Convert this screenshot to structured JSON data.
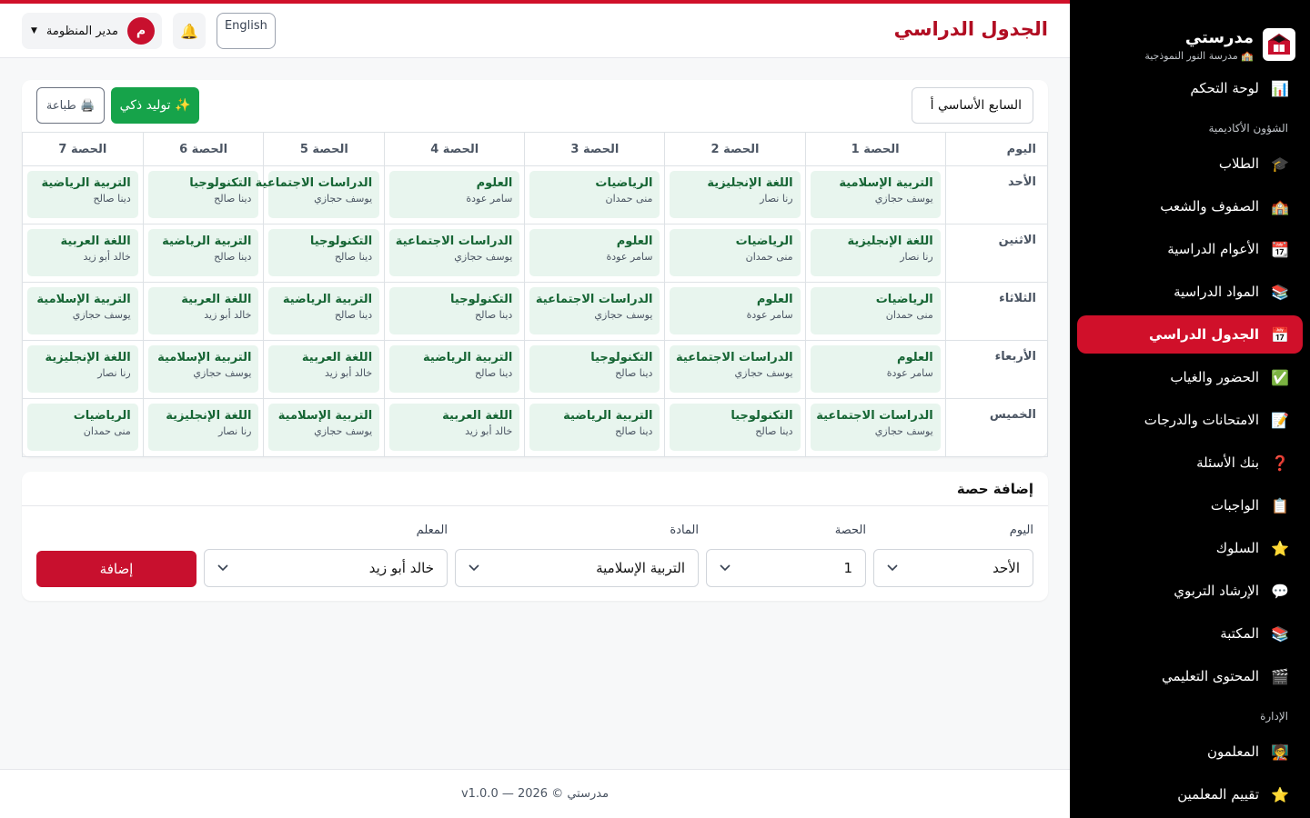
{
  "colors": {
    "accent": "#d0102a",
    "sidebar_bg": "#000000",
    "success": "#16a34a",
    "lesson_bg": "#e8f5ee",
    "lesson_text": "#166534"
  },
  "brand": {
    "name": "مدرستي",
    "school": "🏫 مدرسة النور النموذجية",
    "logo_icon": "school-logo-icon"
  },
  "sidebar": {
    "top": [
      {
        "label": "لوحة التحكم",
        "icon": "📊",
        "icon_name": "dashboard-icon"
      }
    ],
    "sections": [
      {
        "title": "الشؤون الأكاديمية",
        "items": [
          {
            "label": "الطلاب",
            "icon": "🎓",
            "icon_name": "graduation-cap-icon"
          },
          {
            "label": "الصفوف والشعب",
            "icon": "🏫",
            "icon_name": "school-icon"
          },
          {
            "label": "الأعوام الدراسية",
            "icon": "📆",
            "icon_name": "calendar-icon"
          },
          {
            "label": "المواد الدراسية",
            "icon": "📚",
            "icon_name": "books-icon"
          },
          {
            "label": "الجدول الدراسي",
            "icon": "📅",
            "icon_name": "timetable-icon",
            "active": true
          },
          {
            "label": "الحضور والغياب",
            "icon": "✅",
            "icon_name": "check-icon"
          },
          {
            "label": "الامتحانات والدرجات",
            "icon": "📝",
            "icon_name": "memo-icon"
          },
          {
            "label": "بنك الأسئلة",
            "icon": "❓",
            "icon_name": "question-icon"
          },
          {
            "label": "الواجبات",
            "icon": "📋",
            "icon_name": "clipboard-icon"
          },
          {
            "label": "السلوك",
            "icon": "⭐",
            "icon_name": "star-icon"
          },
          {
            "label": "الإرشاد التربوي",
            "icon": "💬",
            "icon_name": "speech-bubble-icon"
          },
          {
            "label": "المكتبة",
            "icon": "📚",
            "icon_name": "library-icon"
          },
          {
            "label": "المحتوى التعليمي",
            "icon": "🎬",
            "icon_name": "clapperboard-icon"
          }
        ]
      },
      {
        "title": "الإدارة",
        "items": [
          {
            "label": "المعلمون",
            "icon": "🧑‍🏫",
            "icon_name": "teacher-icon"
          },
          {
            "label": "تقييم المعلمين",
            "icon": "⭐",
            "icon_name": "star-icon"
          }
        ]
      }
    ]
  },
  "header": {
    "title": "الجدول الدراسي",
    "user_name": "مدير المنظومة",
    "avatar_letter": "م",
    "language_button": "English",
    "bell_icon": "🔔"
  },
  "schedule": {
    "class_selected": "السابع الأساسي أ",
    "ai_generate_label": "✨ توليد ذكي",
    "print_label": "🖨️ طباعة",
    "day_header": "اليوم",
    "periods": [
      "الحصة 1",
      "الحصة 2",
      "الحصة 3",
      "الحصة 4",
      "الحصة 5",
      "الحصة 6",
      "الحصة 7"
    ],
    "rows": [
      {
        "day": "الأحد",
        "lessons": [
          {
            "subject": "التربية الإسلامية",
            "teacher": "يوسف حجازي"
          },
          {
            "subject": "اللغة الإنجليزية",
            "teacher": "رنا نصار"
          },
          {
            "subject": "الرياضيات",
            "teacher": "منى حمدان"
          },
          {
            "subject": "العلوم",
            "teacher": "سامر عودة"
          },
          {
            "subject": "الدراسات الاجتماعية",
            "teacher": "يوسف حجازي"
          },
          {
            "subject": "التكنولوجيا",
            "teacher": "دينا صالح"
          },
          {
            "subject": "التربية الرياضية",
            "teacher": "دينا صالح"
          }
        ]
      },
      {
        "day": "الاثنين",
        "lessons": [
          {
            "subject": "اللغة الإنجليزية",
            "teacher": "رنا نصار"
          },
          {
            "subject": "الرياضيات",
            "teacher": "منى حمدان"
          },
          {
            "subject": "العلوم",
            "teacher": "سامر عودة"
          },
          {
            "subject": "الدراسات الاجتماعية",
            "teacher": "يوسف حجازي"
          },
          {
            "subject": "التكنولوجيا",
            "teacher": "دينا صالح"
          },
          {
            "subject": "التربية الرياضية",
            "teacher": "دينا صالح"
          },
          {
            "subject": "اللغة العربية",
            "teacher": "خالد أبو زيد"
          }
        ]
      },
      {
        "day": "الثلاثاء",
        "lessons": [
          {
            "subject": "الرياضيات",
            "teacher": "منى حمدان"
          },
          {
            "subject": "العلوم",
            "teacher": "سامر عودة"
          },
          {
            "subject": "الدراسات الاجتماعية",
            "teacher": "يوسف حجازي"
          },
          {
            "subject": "التكنولوجيا",
            "teacher": "دينا صالح"
          },
          {
            "subject": "التربية الرياضية",
            "teacher": "دينا صالح"
          },
          {
            "subject": "اللغة العربية",
            "teacher": "خالد أبو زيد"
          },
          {
            "subject": "التربية الإسلامية",
            "teacher": "يوسف حجازي"
          }
        ]
      },
      {
        "day": "الأربعاء",
        "lessons": [
          {
            "subject": "العلوم",
            "teacher": "سامر عودة"
          },
          {
            "subject": "الدراسات الاجتماعية",
            "teacher": "يوسف حجازي"
          },
          {
            "subject": "التكنولوجيا",
            "teacher": "دينا صالح"
          },
          {
            "subject": "التربية الرياضية",
            "teacher": "دينا صالح"
          },
          {
            "subject": "اللغة العربية",
            "teacher": "خالد أبو زيد"
          },
          {
            "subject": "التربية الإسلامية",
            "teacher": "يوسف حجازي"
          },
          {
            "subject": "اللغة الإنجليزية",
            "teacher": "رنا نصار"
          }
        ]
      },
      {
        "day": "الخميس",
        "lessons": [
          {
            "subject": "الدراسات الاجتماعية",
            "teacher": "يوسف حجازي"
          },
          {
            "subject": "التكنولوجيا",
            "teacher": "دينا صالح"
          },
          {
            "subject": "التربية الرياضية",
            "teacher": "دينا صالح"
          },
          {
            "subject": "اللغة العربية",
            "teacher": "خالد أبو زيد"
          },
          {
            "subject": "التربية الإسلامية",
            "teacher": "يوسف حجازي"
          },
          {
            "subject": "اللغة الإنجليزية",
            "teacher": "رنا نصار"
          },
          {
            "subject": "الرياضيات",
            "teacher": "منى حمدان"
          }
        ]
      }
    ]
  },
  "add_lesson": {
    "title": "إضافة حصة",
    "day_label": "اليوم",
    "day_value": "الأحد",
    "period_label": "الحصة",
    "period_value": "1",
    "subject_label": "المادة",
    "subject_value": "التربية الإسلامية",
    "teacher_label": "المعلم",
    "teacher_value": "خالد أبو زيد",
    "submit_label": "إضافة"
  },
  "footer": {
    "text": "مدرستي © 2026 — v1.0.0"
  }
}
